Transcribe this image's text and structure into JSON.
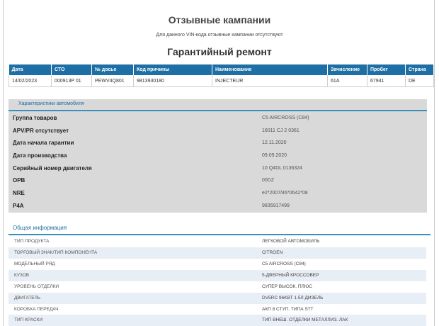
{
  "recalls": {
    "title": "Отзывные кампании",
    "message": "Для данного VIN-кода отзывные кампании отсутствуют"
  },
  "warranty": {
    "title": "Гарантийный ремонт",
    "columns": [
      "Дата",
      "СТО",
      "№ досье",
      "Код причины",
      "Наименование",
      "Зачисление",
      "Пробег",
      "Страна"
    ],
    "rows": [
      [
        "14/02/2023",
        "000913P 01",
        "PEWV4Q801",
        "9813930180",
        "INJECTEUR",
        "61A",
        "67941",
        "DE"
      ]
    ]
  },
  "characteristics": {
    "title": "Характеристики автомобиля",
    "rows": [
      {
        "label": "Группа товаров",
        "value": "C5 AIRCROSS (C84)"
      },
      {
        "label": "APV/PR отсутствует",
        "value": "16011 CJ 2 0361"
      },
      {
        "label": "Дата начала гарантии",
        "value": "12.11.2020"
      },
      {
        "label": "Дата производства",
        "value": "09.09.2020"
      },
      {
        "label": "Серийный номер двигателя",
        "value": "10 Q4DL 0136324"
      },
      {
        "label": "OPB",
        "value": "00DZ"
      },
      {
        "label": "NRE",
        "value": "e2*2007/46*0642*08"
      },
      {
        "label": "P4A",
        "value": "9835917499"
      }
    ]
  },
  "general": {
    "title": "Общая информация",
    "rows": [
      {
        "label": "Тип продукта",
        "value": "Легковой автомобиль"
      },
      {
        "label": "Торговый знак/тип компонента",
        "value": "Citroen"
      },
      {
        "label": "Модельный ряд",
        "value": "C5 AIRCROSS (C84)"
      },
      {
        "label": "Кузов",
        "value": "5-дверный кроссовер"
      },
      {
        "label": "Уровень отделки",
        "value": "Супер высок. плюс"
      },
      {
        "label": "Двигатель",
        "value": "DV5RC 96KBT 1.5л дизель"
      },
      {
        "label": "Коробка передач",
        "value": "АКП 8 ступ. типа STT"
      },
      {
        "label": "Тип краски",
        "value": "Тип внеш. отделки металлиз. лак"
      }
    ]
  }
}
